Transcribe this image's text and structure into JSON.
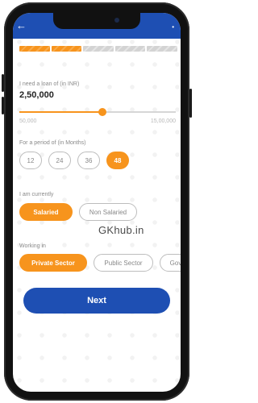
{
  "loan": {
    "label": "I need a loan of (in INR)",
    "amount": "2,50,000",
    "slider_fraction": 0.53,
    "min": "50,000",
    "max": "15,00,000"
  },
  "period": {
    "label": "For a period of (in Months)",
    "options": [
      "12",
      "24",
      "36",
      "48"
    ],
    "selected": "48"
  },
  "employment": {
    "label": "I am currently",
    "options": [
      "Salaried",
      "Non Salaried"
    ],
    "selected": "Salaried"
  },
  "sector": {
    "label": "Working in",
    "options": [
      "Private Sector",
      "Public Sector",
      "Gov"
    ],
    "selected": "Private Sector"
  },
  "watermark": "GKhub.in",
  "next_label": "Next",
  "progress": {
    "completed_fraction": 0.4
  },
  "colors": {
    "primary": "#1e4fb3",
    "accent": "#f7941d"
  },
  "icons": [
    "back-arrow-icon"
  ]
}
